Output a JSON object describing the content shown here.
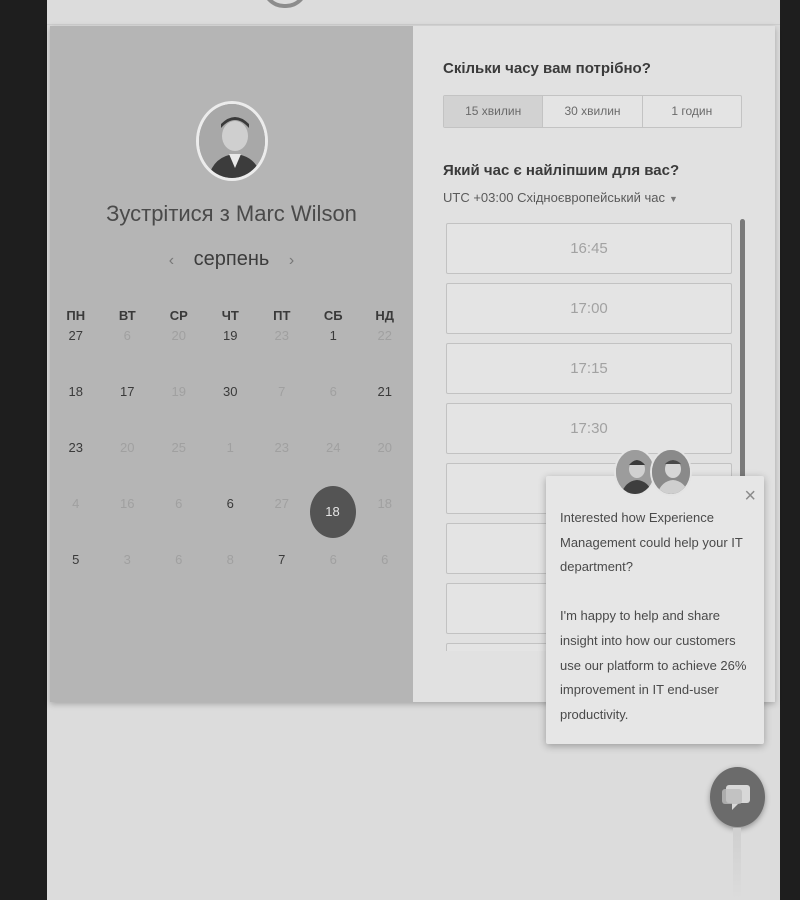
{
  "colors": {
    "selected_day": "#545454",
    "left_panel": "#b5b5b5",
    "right_panel": "#e1e1e1"
  },
  "host": {
    "meet_title": "Зустрітися з Marc Wilson",
    "avatar_icon": "person-avatar-icon"
  },
  "calendar": {
    "prev_arrow": "‹",
    "next_arrow": "›",
    "month": "серпень",
    "weekdays": [
      "ПН",
      "ВТ",
      "СР",
      "ЧТ",
      "ПТ",
      "СБ",
      "НД"
    ],
    "rows": [
      [
        "27",
        "6",
        "20",
        "19",
        "23",
        "1",
        "22"
      ],
      [
        "18",
        "17",
        "19",
        "30",
        "7",
        "6",
        "21"
      ],
      [
        "23",
        "20",
        "25",
        "1",
        "23",
        "24",
        "20"
      ],
      [
        "4",
        "16",
        "6",
        "6",
        "27",
        "18",
        "18"
      ],
      [
        "5",
        "3",
        "6",
        "8",
        "7",
        "6",
        "6"
      ]
    ],
    "active": [
      [
        true,
        false,
        false,
        true,
        false,
        true,
        false
      ],
      [
        true,
        true,
        false,
        true,
        false,
        false,
        true
      ],
      [
        true,
        false,
        false,
        false,
        false,
        false,
        false
      ],
      [
        false,
        false,
        false,
        true,
        false,
        true,
        false
      ],
      [
        true,
        false,
        false,
        false,
        true,
        false,
        false
      ]
    ],
    "selected": {
      "row": 3,
      "col": 5,
      "label": "18"
    }
  },
  "scheduler": {
    "duration_question": "Скільки часу вам потрібно?",
    "durations": [
      "15 хвилин",
      "30 хвилин",
      "1 годин"
    ],
    "active_duration": 0,
    "time_question": "Який час є найліпшим для вас?",
    "timezone": "UTC +03:00 Східноєвропейський час",
    "timezone_caret": "▼",
    "slots": [
      "16:45",
      "17:00",
      "17:15",
      "17:30",
      "",
      "",
      "",
      ""
    ]
  },
  "chat": {
    "close": "×",
    "message": "Interested how Experience Management could help your IT department?\n\nI'm happy to help and share insight into how our customers use our platform to achieve 26% improvement in IT end-user productivity.",
    "agent_icons": [
      "agent-avatar-icon",
      "agent-avatar-icon"
    ],
    "launcher_icon": "chat-bubble-icon"
  }
}
